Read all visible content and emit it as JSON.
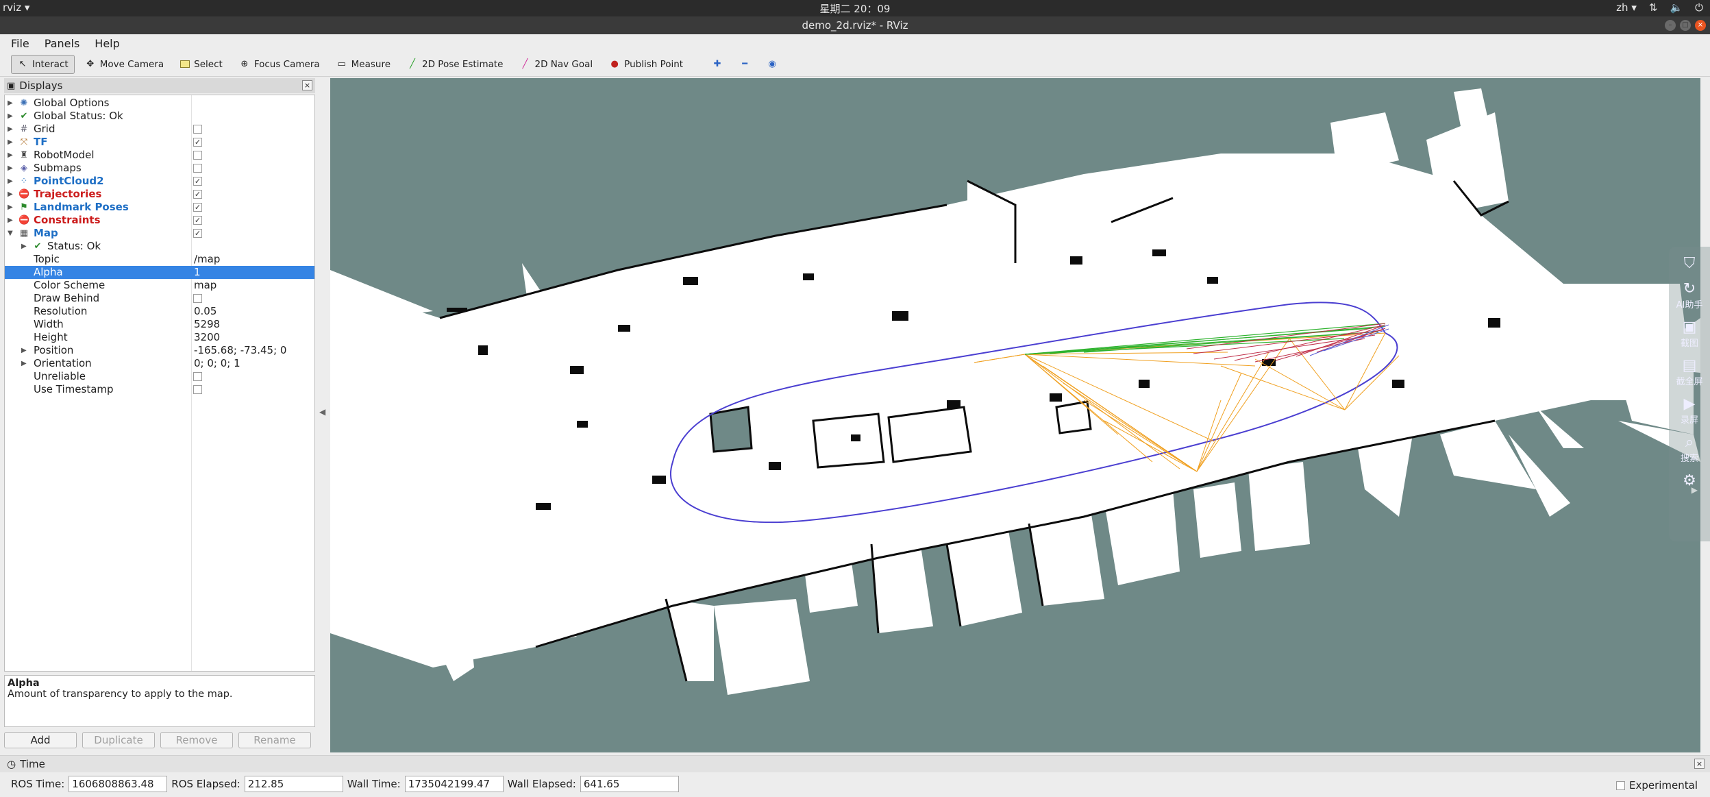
{
  "topbar": {
    "app_label": "rviz ▾",
    "clock": "星期二 20：09",
    "lang": "zh ▾",
    "tray_icons": [
      "network-icon",
      "volume-icon",
      "power-icon"
    ]
  },
  "window": {
    "title": "demo_2d.rviz* - RViz"
  },
  "menu": {
    "file": "File",
    "panels": "Panels",
    "help": "Help"
  },
  "toolbar": {
    "interact": "Interact",
    "move_camera": "Move Camera",
    "select": "Select",
    "focus_camera": "Focus Camera",
    "measure": "Measure",
    "pose_estimate": "2D Pose Estimate",
    "nav_goal": "2D Nav Goal",
    "publish_point": "Publish Point"
  },
  "displays": {
    "title": "Displays",
    "items": [
      {
        "label": "Global Options",
        "icon": "globe-icon",
        "checked": null
      },
      {
        "label": "Global Status: Ok",
        "icon": "check-icon",
        "checked": null
      },
      {
        "label": "Grid",
        "icon": "grid-icon",
        "checked": false
      },
      {
        "label": "TF",
        "icon": "tf-icon",
        "checked": true
      },
      {
        "label": "RobotModel",
        "icon": "robot-icon",
        "checked": false
      },
      {
        "label": "Submaps",
        "icon": "submaps-icon",
        "checked": false
      },
      {
        "label": "PointCloud2",
        "icon": "pointcloud-icon",
        "checked": true
      },
      {
        "label": "Trajectories",
        "icon": "error-icon",
        "checked": true
      },
      {
        "label": "Landmark Poses",
        "icon": "landmark-icon",
        "checked": true
      },
      {
        "label": "Constraints",
        "icon": "error-icon",
        "checked": true
      },
      {
        "label": "Map",
        "icon": "map-icon",
        "checked": true
      }
    ],
    "map_props": {
      "status": "Status: Ok",
      "topic_label": "Topic",
      "topic_value": "/map",
      "alpha_label": "Alpha",
      "alpha_value": "1",
      "color_scheme_label": "Color Scheme",
      "color_scheme_value": "map",
      "draw_behind_label": "Draw Behind",
      "resolution_label": "Resolution",
      "resolution_value": "0.05",
      "width_label": "Width",
      "width_value": "5298",
      "height_label": "Height",
      "height_value": "3200",
      "position_label": "Position",
      "position_value": "-165.68; -73.45; 0",
      "orientation_label": "Orientation",
      "orientation_value": "0; 0; 0; 1",
      "unreliable_label": "Unreliable",
      "use_timestamp_label": "Use Timestamp"
    },
    "description_title": "Alpha",
    "description_text": "Amount of transparency to apply to the map.",
    "buttons": {
      "add": "Add",
      "duplicate": "Duplicate",
      "remove": "Remove",
      "rename": "Rename"
    }
  },
  "floater": {
    "items": [
      {
        "icon": "shield-icon",
        "label": ""
      },
      {
        "icon": "ai-assistant-icon",
        "label": "AI助手"
      },
      {
        "icon": "camera-icon",
        "label": "截图"
      },
      {
        "icon": "fullscreen-capture-icon",
        "label": "截全屏"
      },
      {
        "icon": "video-icon",
        "label": "录屏"
      },
      {
        "icon": "search-icon",
        "label": "搜索"
      },
      {
        "icon": "settings-icon",
        "label": ""
      }
    ]
  },
  "time": {
    "title": "Time",
    "ros_time_label": "ROS Time:",
    "ros_time": "1606808863.48",
    "ros_elapsed_label": "ROS Elapsed:",
    "ros_elapsed": "212.85",
    "wall_time_label": "Wall Time:",
    "wall_time": "1735042199.47",
    "wall_elapsed_label": "Wall Elapsed:",
    "wall_elapsed": "641.65",
    "experimental": "Experimental"
  },
  "colors": {
    "map_unknown": "#6f8987",
    "map_free": "#ffffff",
    "map_occupied": "#000000",
    "trajectory": "#4b3fd1",
    "constraints_orange": "#f0a020",
    "constraints_green": "#2fb32f",
    "constraints_red": "#c0304a",
    "selection": "#3584e4"
  }
}
